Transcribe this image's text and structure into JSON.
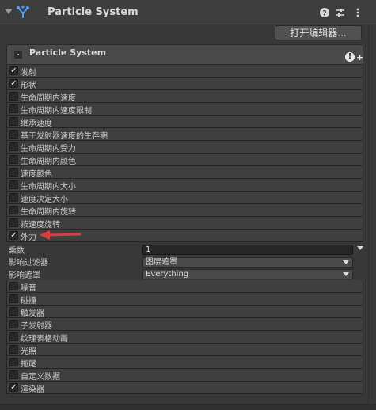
{
  "component": {
    "title": "Particle System",
    "open_editor_label": "打开编辑器...",
    "icons": [
      "fold-arrow-icon",
      "particle-system-icon",
      "help-icon",
      "preset-icon",
      "menu-icon"
    ]
  },
  "main_module": {
    "title": "Particle System",
    "icons": [
      "particle-dot-icon",
      "warning-icon",
      "add-icon"
    ]
  },
  "modules_top": [
    {
      "label": "发射",
      "checked": true
    },
    {
      "label": "形状",
      "checked": true
    },
    {
      "label": "生命周期内速度",
      "checked": false
    },
    {
      "label": "生命周期内速度限制",
      "checked": false
    },
    {
      "label": "继承速度",
      "checked": false
    },
    {
      "label": "基于发射器速度的生存期",
      "checked": false
    },
    {
      "label": "生命周期内受力",
      "checked": false
    },
    {
      "label": "生命周期内颜色",
      "checked": false
    },
    {
      "label": "速度颜色",
      "checked": false
    },
    {
      "label": "生命周期内大小",
      "checked": false
    },
    {
      "label": "速度决定大小",
      "checked": false
    },
    {
      "label": "生命周期内旋转",
      "checked": false
    },
    {
      "label": "按速度旋转",
      "checked": false
    },
    {
      "label": "外力",
      "checked": true
    }
  ],
  "external_forces": {
    "multiplier_label": "乘数",
    "multiplier_value": "1",
    "influence_filter_label": "影响过滤器",
    "influence_filter_value": "图层遮罩",
    "influence_mask_label": "影响遮罩",
    "influence_mask_value": "Everything"
  },
  "modules_bottom": [
    {
      "label": "噪音",
      "checked": false
    },
    {
      "label": "碰撞",
      "checked": false
    },
    {
      "label": "触发器",
      "checked": false
    },
    {
      "label": "子发射器",
      "checked": false
    },
    {
      "label": "纹理表格动画",
      "checked": false
    },
    {
      "label": "光照",
      "checked": false
    },
    {
      "label": "拖尾",
      "checked": false
    },
    {
      "label": "自定义数据",
      "checked": false
    },
    {
      "label": "渲染器",
      "checked": true
    }
  ],
  "colors": {
    "annotation_arrow": "#e23b3b",
    "icon_blue": "#4aa3ff"
  }
}
